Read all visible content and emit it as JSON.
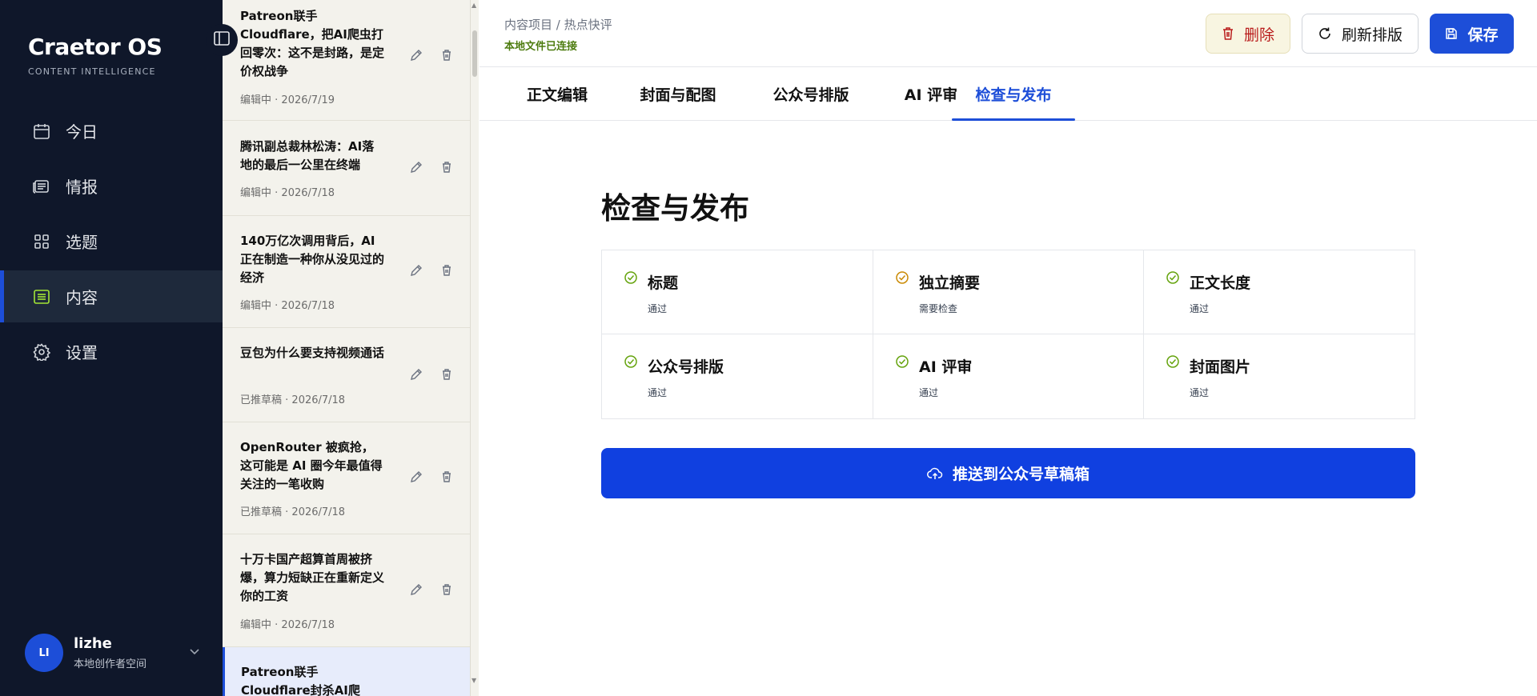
{
  "brand": {
    "name": "Craetor OS",
    "subtitle": "CONTENT INTELLIGENCE"
  },
  "nav": [
    {
      "label": "今日",
      "icon": "calendar-icon"
    },
    {
      "label": "情报",
      "icon": "newspaper-icon"
    },
    {
      "label": "选题",
      "icon": "grid-icon"
    },
    {
      "label": "内容",
      "icon": "document-icon",
      "active": true
    },
    {
      "label": "设置",
      "icon": "gear-icon"
    }
  ],
  "user": {
    "initials": "LI",
    "name": "lizhe",
    "space": "本地创作者空间"
  },
  "articles": [
    {
      "title": "Patreon联手Cloudflare，把AI爬虫打回零次：这不是封路，是定价权战争",
      "status": "编辑中",
      "date": "2026/7/19"
    },
    {
      "title": "腾讯副总裁林松涛：AI落地的最后一公里在终端",
      "status": "编辑中",
      "date": "2026/7/18"
    },
    {
      "title": "140万亿次调用背后，AI正在制造一种你从没见过的经济",
      "status": "编辑中",
      "date": "2026/7/18"
    },
    {
      "title": "豆包为什么要支持视频通话",
      "status": "已推草稿",
      "date": "2026/7/18"
    },
    {
      "title": "OpenRouter 被疯抢，这可能是 AI 圈今年最值得关注的一笔收购",
      "status": "已推草稿",
      "date": "2026/7/18"
    },
    {
      "title": "十万卡国产超算首周被挤爆，算力短缺正在重新定义你的工资",
      "status": "编辑中",
      "date": "2026/7/18"
    },
    {
      "title": "Patreon联手Cloudflare封杀AI爬",
      "status": "",
      "date": ""
    }
  ],
  "header": {
    "breadcrumb": "内容项目 / 热点快评",
    "connection": "本地文件已连接",
    "delete_label": "删除",
    "refresh_label": "刷新排版",
    "save_label": "保存"
  },
  "tabs": [
    {
      "label": "正文编辑"
    },
    {
      "label": "封面与配图"
    },
    {
      "label": "公众号排版"
    },
    {
      "label": "AI 评审"
    },
    {
      "label": "检查与发布",
      "active": true
    }
  ],
  "review": {
    "title": "检查与发布",
    "checks": [
      {
        "label": "标题",
        "status": "通过",
        "state": "pass"
      },
      {
        "label": "独立摘要",
        "status": "需要检查",
        "state": "warn"
      },
      {
        "label": "正文长度",
        "status": "通过",
        "state": "pass"
      },
      {
        "label": "公众号排版",
        "status": "通过",
        "state": "pass"
      },
      {
        "label": "AI 评审",
        "status": "通过",
        "state": "pass"
      },
      {
        "label": "封面图片",
        "status": "通过",
        "state": "pass"
      }
    ],
    "publish_label": "推送到公众号草稿箱"
  },
  "colors": {
    "accent": "#1d4ed8",
    "sidebar": "#0f172a",
    "pass": "#65a30d",
    "warn": "#ca8a04",
    "danger": "#b91c1c"
  }
}
